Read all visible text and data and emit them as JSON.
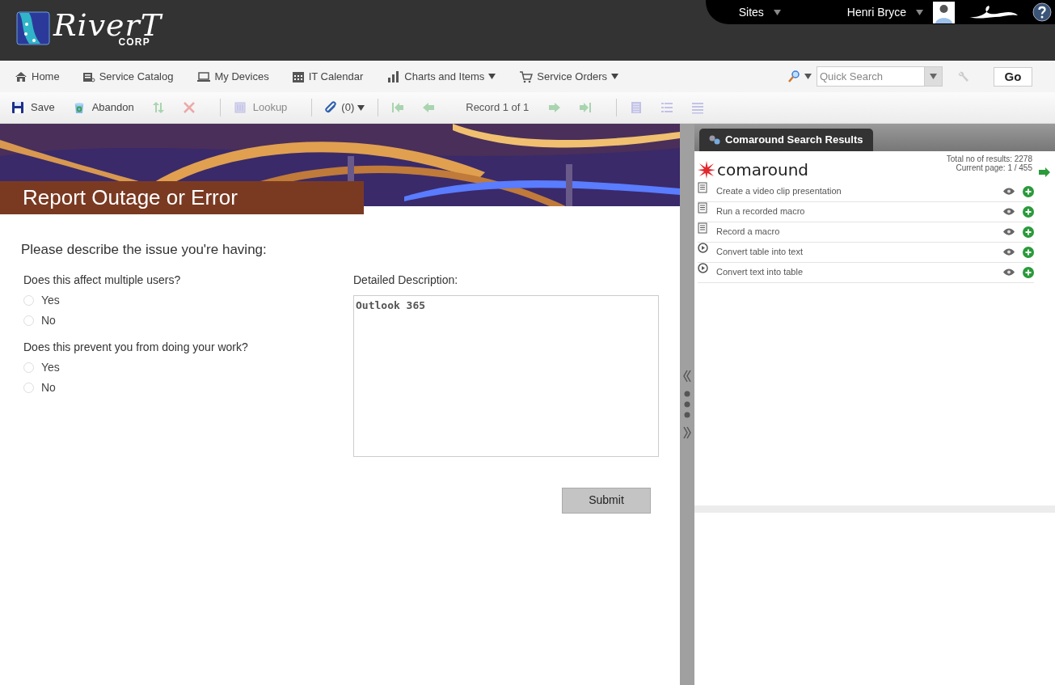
{
  "header": {
    "logo": {
      "name": "RiverT",
      "sub": "CORP"
    },
    "sites": "Sites",
    "user": "Henri Bryce"
  },
  "nav": {
    "items": [
      {
        "label": "Home",
        "dropdown": false
      },
      {
        "label": "Service Catalog",
        "dropdown": false
      },
      {
        "label": "My Devices",
        "dropdown": false
      },
      {
        "label": "IT Calendar",
        "dropdown": false
      },
      {
        "label": "Charts and Items",
        "dropdown": true
      },
      {
        "label": "Service Orders",
        "dropdown": true
      }
    ],
    "search": {
      "placeholder": "Quick Search"
    },
    "go": "Go"
  },
  "toolbar": [
    {
      "kind": "button",
      "label": "Save",
      "disabled": false
    },
    {
      "kind": "button",
      "label": "Abandon",
      "disabled": false
    },
    {
      "kind": "button",
      "disabled": true
    },
    {
      "kind": "button",
      "disabled": true
    },
    {
      "kind": "separator"
    },
    {
      "kind": "button",
      "label": "Lookup",
      "disabled": true
    },
    {
      "kind": "separator"
    },
    {
      "kind": "attach",
      "label": "(0)",
      "disabled": false
    },
    {
      "kind": "separator"
    },
    {
      "kind": "button",
      "disabled": true
    },
    {
      "kind": "button",
      "disabled": true
    },
    {
      "kind": "text",
      "label": "Record 1 of 1"
    },
    {
      "kind": "button",
      "disabled": true
    },
    {
      "kind": "button",
      "disabled": true
    },
    {
      "kind": "separator"
    },
    {
      "kind": "button",
      "disabled": true
    },
    {
      "kind": "button",
      "disabled": true
    },
    {
      "kind": "button",
      "disabled": true
    }
  ],
  "banner": {
    "title": "Report Outage or Error"
  },
  "form": {
    "heading": "Please describe the issue you're having:",
    "questions": [
      {
        "label": "Does this affect multiple users?",
        "options": [
          {
            "label": "Yes",
            "selected": false
          },
          {
            "label": "No",
            "selected": false
          }
        ]
      },
      {
        "label": "Does this prevent you from doing your work?",
        "options": [
          {
            "label": "Yes",
            "selected": false
          },
          {
            "label": "No",
            "selected": false
          }
        ]
      }
    ],
    "description": {
      "label": "Detailed Description:",
      "value": "Outlook 365"
    },
    "submit": "Submit"
  },
  "results_panel": {
    "tab": "Comaround Search Results",
    "brand": "comaround",
    "total": "Total no of results: 2278",
    "page": "Current page: 1 / 455",
    "results": [
      {
        "title": "Create a video clip presentation",
        "kind": "document"
      },
      {
        "title": "Run a recorded macro",
        "kind": "document"
      },
      {
        "title": "Record a macro",
        "kind": "document"
      },
      {
        "title": "Convert table into text",
        "kind": "video"
      },
      {
        "title": "Convert text into table",
        "kind": "video"
      }
    ]
  }
}
